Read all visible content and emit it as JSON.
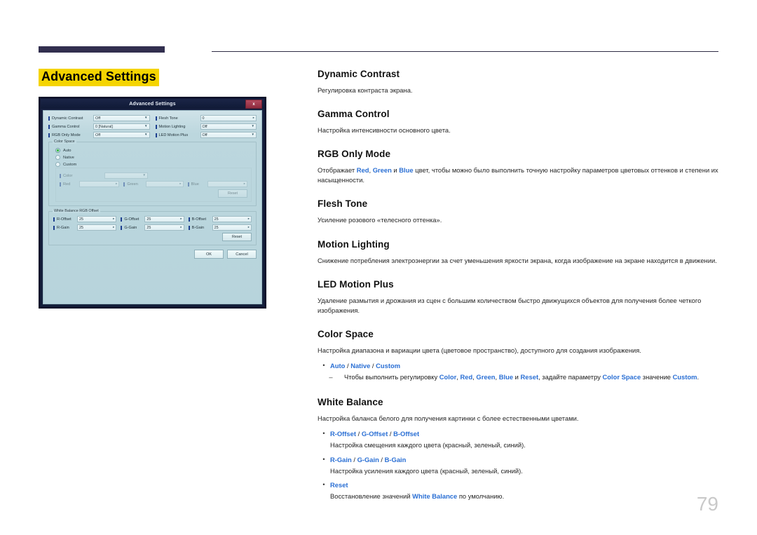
{
  "page": {
    "title": "Advanced Settings",
    "number": "79"
  },
  "dialog": {
    "title": "Advanced Settings",
    "close_label": "x",
    "fields": [
      {
        "label": "Dynamic Contrast",
        "value": "Off",
        "type": "dropdown"
      },
      {
        "label": "Flesh Tone",
        "value": "0",
        "type": "spinner"
      },
      {
        "label": "Gamma Control",
        "value": "0 [Natural]",
        "type": "dropdown"
      },
      {
        "label": "Motion Lighting",
        "value": "Off",
        "type": "dropdown"
      },
      {
        "label": "RGB Only Mode",
        "value": "Off",
        "type": "dropdown"
      },
      {
        "label": "LED Motion Plus",
        "value": "Off",
        "type": "dropdown"
      }
    ],
    "color_space": {
      "caption": "Color Space",
      "options": [
        {
          "label": "Auto",
          "selected": true
        },
        {
          "label": "Native",
          "selected": false
        },
        {
          "label": "Custom",
          "selected": false
        }
      ],
      "custom": {
        "caption": "Custom",
        "color_label": "Color",
        "color_value": "",
        "red_label": "Red",
        "red_value": "",
        "green_label": "Green",
        "green_value": "",
        "blue_label": "Blue",
        "blue_value": "",
        "reset_label": "Reset"
      }
    },
    "white_balance": {
      "caption": "White Balance RGB Offset",
      "rows": [
        {
          "label": "R-Offset",
          "value": "25"
        },
        {
          "label": "G-Offset",
          "value": "25"
        },
        {
          "label": "B-Offset",
          "value": "25"
        },
        {
          "label": "R-Gain",
          "value": "25"
        },
        {
          "label": "G-Gain",
          "value": "25"
        },
        {
          "label": "B-Gain",
          "value": "25"
        }
      ],
      "reset_label": "Reset"
    },
    "footer": {
      "ok_label": "OK",
      "cancel_label": "Cancel"
    }
  },
  "doc": {
    "dynamic_contrast": {
      "heading": "Dynamic Contrast",
      "body": "Регулировка контраста экрана."
    },
    "gamma_control": {
      "heading": "Gamma Control",
      "body": "Настройка интенсивности основного цвета."
    },
    "rgb_only_mode": {
      "heading": "RGB Only Mode",
      "body_pre": "Отображает ",
      "red": "Red",
      "sep1": ", ",
      "green": "Green",
      "sep2": " и ",
      "blue": "Blue",
      "body_post": " цвет, чтобы можно было выполнить точную настройку параметров цветовых оттенков и степени их насыщенности."
    },
    "flesh_tone": {
      "heading": "Flesh Tone",
      "body": "Усиление розового «телесного оттенка»."
    },
    "motion_lighting": {
      "heading": "Motion Lighting",
      "body": "Снижение потребления электроэнергии за счет уменьшения яркости экрана, когда изображение на экране находится в движении."
    },
    "led_motion_plus": {
      "heading": "LED Motion Plus",
      "body": "Удаление размытия и дрожания из сцен с большим количеством быстро движущихся объектов для получения более четкого изображения."
    },
    "color_space": {
      "heading": "Color Space",
      "body": "Настройка диапазона и вариации цвета (цветовое пространство), доступного для создания изображения.",
      "bullet_mark": "•",
      "sub_mark": "–",
      "option_auto": "Auto",
      "slash1": " / ",
      "option_native": "Native",
      "slash2": " / ",
      "option_custom": "Custom",
      "sub_pre": "Чтобы выполнить регулировку ",
      "t_color": "Color",
      "t_sep1": ", ",
      "t_red": "Red",
      "t_sep2": ", ",
      "t_green": "Green",
      "t_sep3": ", ",
      "t_blue": "Blue",
      "t_sep4": " и ",
      "t_reset": "Reset",
      "sub_mid": ", задайте параметру ",
      "t_colorspace": "Color Space",
      "sub_tail": " значение ",
      "t_custom": "Custom",
      "sub_end": "."
    },
    "white_balance": {
      "heading": "White Balance",
      "body": "Настройка баланса белого для получения картинки с более естественными цветами.",
      "bullet_mark": "•",
      "offset_r": "R-Offset",
      "offset_sep1": " / ",
      "offset_g": "G-Offset",
      "offset_sep2": " / ",
      "offset_b": "B-Offset",
      "offset_desc": "Настройка смещения каждого цвета (красный, зеленый, синий).",
      "gain_r": "R-Gain",
      "gain_sep1": " / ",
      "gain_g": "G-Gain",
      "gain_sep2": " / ",
      "gain_b": "B-Gain",
      "gain_desc": "Настройка усиления каждого цвета (красный, зеленый, синий).",
      "reset": "Reset",
      "reset_pre": "Восстановление значений ",
      "reset_term": "White Balance",
      "reset_post": " по умолчанию."
    }
  }
}
